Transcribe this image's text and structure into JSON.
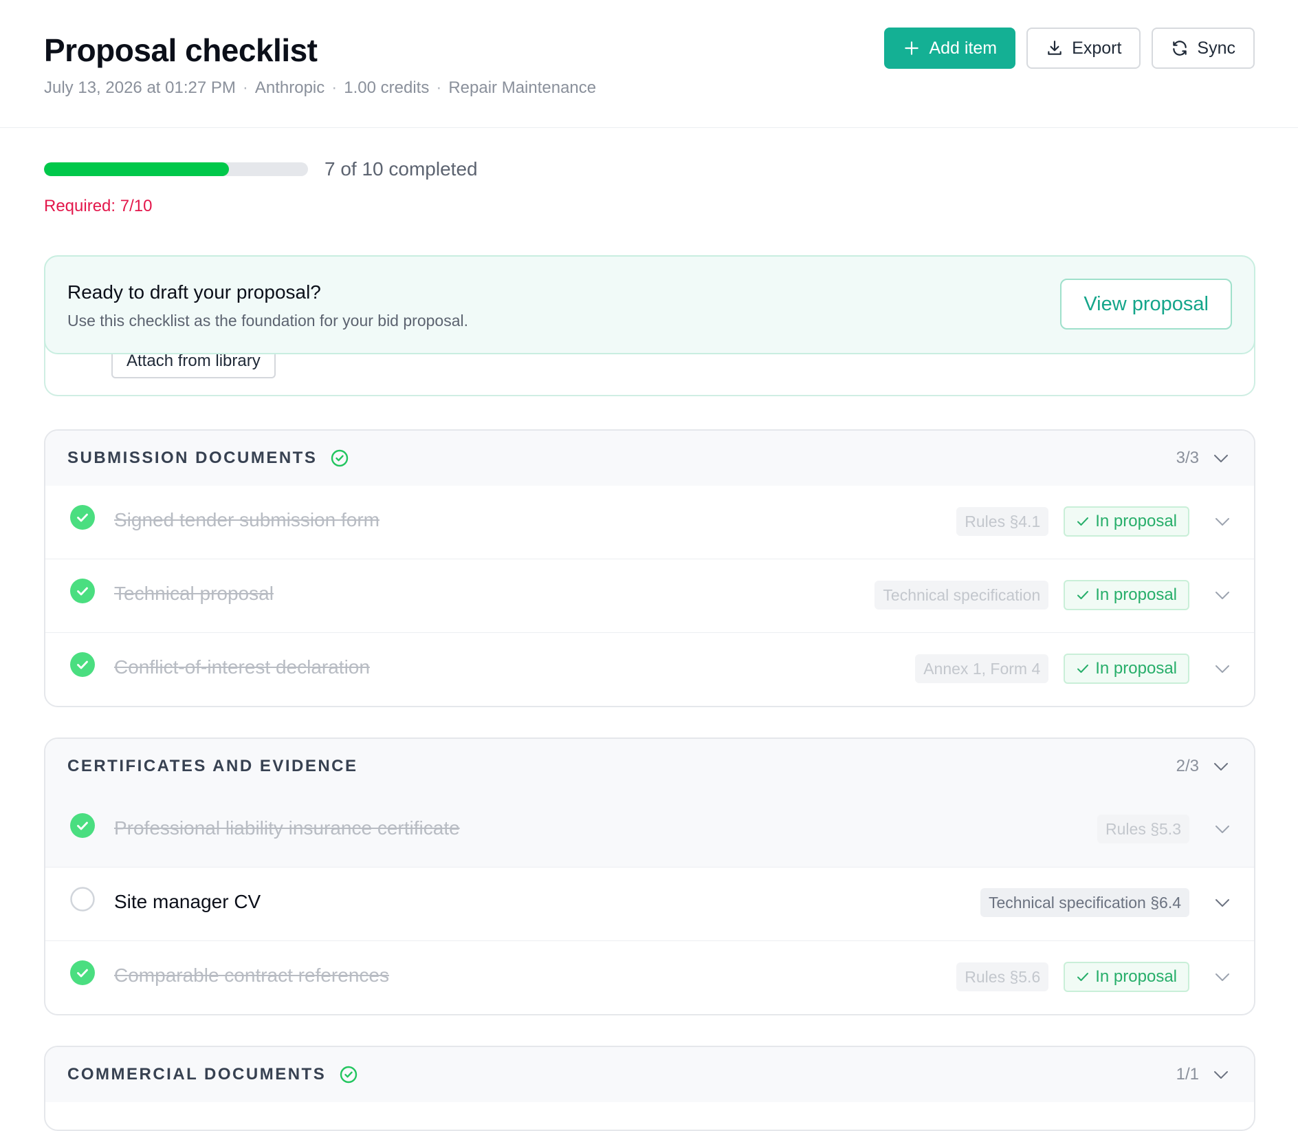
{
  "header": {
    "title": "Proposal checklist",
    "meta": [
      "July 13, 2026 at 01:27 PM",
      "Anthropic",
      "1.00 credits",
      "Repair Maintenance"
    ],
    "separator": "·",
    "actions": {
      "add_label": "Add item",
      "export_label": "Export",
      "sync_label": "Sync"
    }
  },
  "progress": {
    "completed": 7,
    "total": 10,
    "label": "7 of 10 completed",
    "required_label": "Required: 7/10",
    "fraction": 0.7
  },
  "banner": {
    "title": "Ready to draft your proposal?",
    "subtitle": "Use this checklist as the foundation for your bid proposal.",
    "button_label": "View proposal",
    "attach_label": "Attach from library"
  },
  "sections": [
    {
      "title": "SUBMISSION DOCUMENTS",
      "count": "3/3",
      "complete": true,
      "items": [
        {
          "label": "Signed tender submission form",
          "done": true,
          "tag": "Rules §4.1",
          "in_proposal": "In proposal"
        },
        {
          "label": "Technical proposal",
          "done": true,
          "tag": "Technical specification",
          "in_proposal": "In proposal"
        },
        {
          "label": "Conflict-of-interest declaration",
          "done": true,
          "tag": "Annex 1, Form 4",
          "in_proposal": "In proposal"
        }
      ]
    },
    {
      "title": "CERTIFICATES AND EVIDENCE",
      "count": "2/3",
      "complete": false,
      "items": [
        {
          "label": "Professional liability insurance certificate",
          "done": true,
          "tag": "Rules §5.3",
          "in_proposal": ""
        },
        {
          "label": "Site manager CV",
          "done": false,
          "tag": "Technical specification §6.4",
          "in_proposal": ""
        },
        {
          "label": "Comparable contract references",
          "done": true,
          "tag": "Rules §5.6",
          "in_proposal": "In proposal"
        }
      ]
    },
    {
      "title": "COMMERCIAL DOCUMENTS",
      "count": "1/1",
      "complete": true,
      "items": []
    }
  ],
  "colors": {
    "accent": "#14b094",
    "progress": "#00c84a",
    "required": "#e3174b",
    "check": "#4ade80"
  },
  "icons": {
    "add": "plus-icon",
    "export": "download-icon",
    "sync": "sync-icon",
    "check": "check-circle-icon",
    "chevron": "chevron-down-icon"
  }
}
